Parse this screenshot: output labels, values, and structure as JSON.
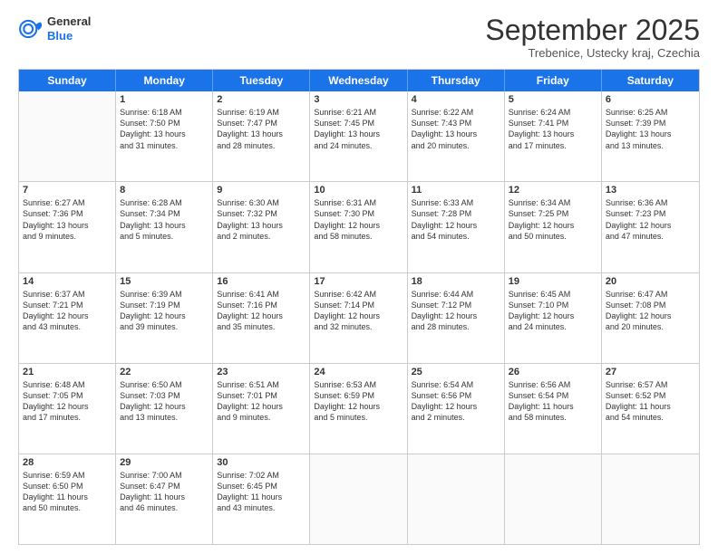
{
  "header": {
    "logo_general": "General",
    "logo_blue": "Blue",
    "month_title": "September 2025",
    "subtitle": "Trebenice, Ustecky kraj, Czechia"
  },
  "weekdays": [
    "Sunday",
    "Monday",
    "Tuesday",
    "Wednesday",
    "Thursday",
    "Friday",
    "Saturday"
  ],
  "rows": [
    [
      {
        "day": "",
        "info": ""
      },
      {
        "day": "1",
        "info": "Sunrise: 6:18 AM\nSunset: 7:50 PM\nDaylight: 13 hours\nand 31 minutes."
      },
      {
        "day": "2",
        "info": "Sunrise: 6:19 AM\nSunset: 7:47 PM\nDaylight: 13 hours\nand 28 minutes."
      },
      {
        "day": "3",
        "info": "Sunrise: 6:21 AM\nSunset: 7:45 PM\nDaylight: 13 hours\nand 24 minutes."
      },
      {
        "day": "4",
        "info": "Sunrise: 6:22 AM\nSunset: 7:43 PM\nDaylight: 13 hours\nand 20 minutes."
      },
      {
        "day": "5",
        "info": "Sunrise: 6:24 AM\nSunset: 7:41 PM\nDaylight: 13 hours\nand 17 minutes."
      },
      {
        "day": "6",
        "info": "Sunrise: 6:25 AM\nSunset: 7:39 PM\nDaylight: 13 hours\nand 13 minutes."
      }
    ],
    [
      {
        "day": "7",
        "info": "Sunrise: 6:27 AM\nSunset: 7:36 PM\nDaylight: 13 hours\nand 9 minutes."
      },
      {
        "day": "8",
        "info": "Sunrise: 6:28 AM\nSunset: 7:34 PM\nDaylight: 13 hours\nand 5 minutes."
      },
      {
        "day": "9",
        "info": "Sunrise: 6:30 AM\nSunset: 7:32 PM\nDaylight: 13 hours\nand 2 minutes."
      },
      {
        "day": "10",
        "info": "Sunrise: 6:31 AM\nSunset: 7:30 PM\nDaylight: 12 hours\nand 58 minutes."
      },
      {
        "day": "11",
        "info": "Sunrise: 6:33 AM\nSunset: 7:28 PM\nDaylight: 12 hours\nand 54 minutes."
      },
      {
        "day": "12",
        "info": "Sunrise: 6:34 AM\nSunset: 7:25 PM\nDaylight: 12 hours\nand 50 minutes."
      },
      {
        "day": "13",
        "info": "Sunrise: 6:36 AM\nSunset: 7:23 PM\nDaylight: 12 hours\nand 47 minutes."
      }
    ],
    [
      {
        "day": "14",
        "info": "Sunrise: 6:37 AM\nSunset: 7:21 PM\nDaylight: 12 hours\nand 43 minutes."
      },
      {
        "day": "15",
        "info": "Sunrise: 6:39 AM\nSunset: 7:19 PM\nDaylight: 12 hours\nand 39 minutes."
      },
      {
        "day": "16",
        "info": "Sunrise: 6:41 AM\nSunset: 7:16 PM\nDaylight: 12 hours\nand 35 minutes."
      },
      {
        "day": "17",
        "info": "Sunrise: 6:42 AM\nSunset: 7:14 PM\nDaylight: 12 hours\nand 32 minutes."
      },
      {
        "day": "18",
        "info": "Sunrise: 6:44 AM\nSunset: 7:12 PM\nDaylight: 12 hours\nand 28 minutes."
      },
      {
        "day": "19",
        "info": "Sunrise: 6:45 AM\nSunset: 7:10 PM\nDaylight: 12 hours\nand 24 minutes."
      },
      {
        "day": "20",
        "info": "Sunrise: 6:47 AM\nSunset: 7:08 PM\nDaylight: 12 hours\nand 20 minutes."
      }
    ],
    [
      {
        "day": "21",
        "info": "Sunrise: 6:48 AM\nSunset: 7:05 PM\nDaylight: 12 hours\nand 17 minutes."
      },
      {
        "day": "22",
        "info": "Sunrise: 6:50 AM\nSunset: 7:03 PM\nDaylight: 12 hours\nand 13 minutes."
      },
      {
        "day": "23",
        "info": "Sunrise: 6:51 AM\nSunset: 7:01 PM\nDaylight: 12 hours\nand 9 minutes."
      },
      {
        "day": "24",
        "info": "Sunrise: 6:53 AM\nSunset: 6:59 PM\nDaylight: 12 hours\nand 5 minutes."
      },
      {
        "day": "25",
        "info": "Sunrise: 6:54 AM\nSunset: 6:56 PM\nDaylight: 12 hours\nand 2 minutes."
      },
      {
        "day": "26",
        "info": "Sunrise: 6:56 AM\nSunset: 6:54 PM\nDaylight: 11 hours\nand 58 minutes."
      },
      {
        "day": "27",
        "info": "Sunrise: 6:57 AM\nSunset: 6:52 PM\nDaylight: 11 hours\nand 54 minutes."
      }
    ],
    [
      {
        "day": "28",
        "info": "Sunrise: 6:59 AM\nSunset: 6:50 PM\nDaylight: 11 hours\nand 50 minutes."
      },
      {
        "day": "29",
        "info": "Sunrise: 7:00 AM\nSunset: 6:47 PM\nDaylight: 11 hours\nand 46 minutes."
      },
      {
        "day": "30",
        "info": "Sunrise: 7:02 AM\nSunset: 6:45 PM\nDaylight: 11 hours\nand 43 minutes."
      },
      {
        "day": "",
        "info": ""
      },
      {
        "day": "",
        "info": ""
      },
      {
        "day": "",
        "info": ""
      },
      {
        "day": "",
        "info": ""
      }
    ]
  ]
}
